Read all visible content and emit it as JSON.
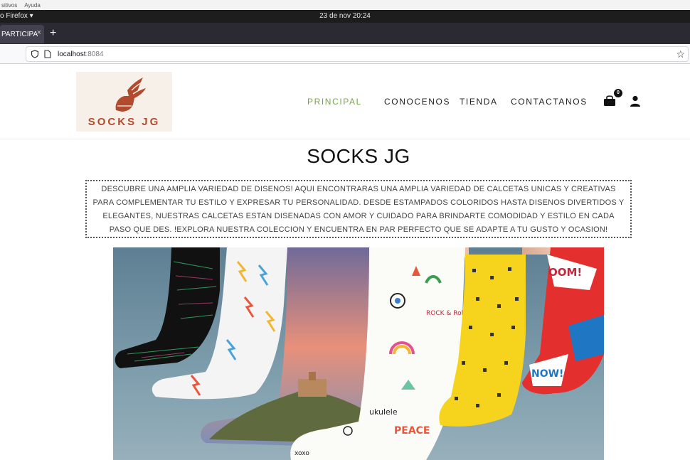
{
  "os": {
    "app_menu": [
      "sitivos",
      "Ayuda"
    ],
    "app_name": "o Firefox ▾",
    "clock": "23 de nov  20:24"
  },
  "browser": {
    "tab_title": "PARTICIPA",
    "url_host": "localhost",
    "url_port": ":8084"
  },
  "site": {
    "logo_text": "SOCKS JG",
    "nav": [
      "PRINCIPAL",
      "CONOCENOS",
      "TIENDA",
      "CONTACTANOS"
    ],
    "cart_count": "0",
    "title": "SOCKS JG",
    "description": "DESCUBRE UNA AMPLIA VARIEDAD DE DISENOS! AQUI ENCONTRARAS UNA AMPLIA VARIEDAD DE CALCETAS UNICAS Y CREATIVAS PARA COMPLEMENTAR TU ESTILO Y EXPRESAR TU PERSONALIDAD. DESDE ESTAMPADOS COLORIDOS HASTA DISENOS DIVERTIDOS Y ELEGANTES, NUESTRAS CALCETAS ESTAN DISENADAS CON AMOR Y CUIDADO PARA BRINDARTE COMODIDAD Y ESTILO EN CADA PASO QUE DES. !EXPLORA NUESTRA COLECCION Y ENCUENTRA EN PAR PERFECTO QUE SE ADAPTE A TU GUSTO Y OCASION!",
    "hero_words": [
      "ukulele",
      "ROCK & Roll",
      "PEACE",
      "xoxo",
      "NOW!",
      "OOM!"
    ]
  },
  "colors": {
    "accent_active_nav": "#7aa64a",
    "logo_brown": "#b14a2e",
    "topbar": "#1d1d1d"
  }
}
